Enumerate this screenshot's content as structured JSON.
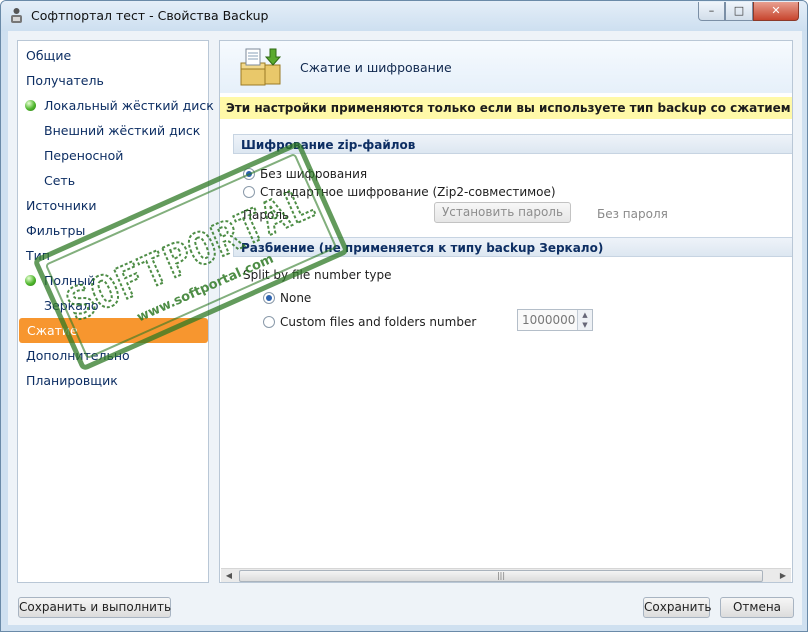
{
  "window": {
    "title": "Софтпортал тест - Свойства Backup",
    "controls": {
      "minimize": "–",
      "maximize": "□",
      "close": "✕"
    }
  },
  "sidebar": {
    "items": [
      {
        "label": "Общие",
        "indent": 0,
        "dot": false,
        "active": false
      },
      {
        "label": "Получатель",
        "indent": 0,
        "dot": false,
        "active": false
      },
      {
        "label": "Локальный жёсткий диск",
        "indent": 1,
        "dot": true,
        "active": false
      },
      {
        "label": "Внешний жёсткий диск",
        "indent": 1,
        "dot": false,
        "active": false
      },
      {
        "label": "Переносной",
        "indent": 1,
        "dot": false,
        "active": false
      },
      {
        "label": "Сеть",
        "indent": 1,
        "dot": false,
        "active": false
      },
      {
        "label": "Источники",
        "indent": 0,
        "dot": false,
        "active": false
      },
      {
        "label": "Фильтры",
        "indent": 0,
        "dot": false,
        "active": false
      },
      {
        "label": "Тип",
        "indent": 0,
        "dot": false,
        "active": false
      },
      {
        "label": "Полный",
        "indent": 1,
        "dot": true,
        "active": false
      },
      {
        "label": "Зеркало",
        "indent": 1,
        "dot": false,
        "active": false
      },
      {
        "label": "Сжатие",
        "indent": 0,
        "dot": false,
        "active": true
      },
      {
        "label": "Дополнительно",
        "indent": 0,
        "dot": false,
        "active": false
      },
      {
        "label": "Планировщик",
        "indent": 0,
        "dot": false,
        "active": false
      }
    ]
  },
  "panel": {
    "title": "Сжатие и шифрование",
    "notice": "Эти настройки применяются только если вы используете тип backup со сжатием zip (наприме",
    "encryption": {
      "header": "Шифрование zip-файлов",
      "options": [
        {
          "label": "Без шифрования",
          "checked": true
        },
        {
          "label": "Стандартное шифрование (Zip2-совместимое)",
          "checked": false
        }
      ],
      "password_label": "Пароль",
      "set_password_button": "Установить пароль",
      "password_status": "Без пароля"
    },
    "split": {
      "header": "Разбиение (не применяется к типу backup Зеркало)",
      "label": "Split by file number type",
      "options": [
        {
          "label": "None",
          "checked": true
        },
        {
          "label": "Custom files and folders number",
          "checked": false
        }
      ],
      "number_value": "1000000"
    },
    "scrollbar_grip": "|||"
  },
  "footer": {
    "save_run_button": "Сохранить и выполнить",
    "save_button": "Сохранить",
    "cancel_button": "Отмена"
  },
  "watermark": {
    "text": "SOFTPORTAL",
    "url": "www.softportal.com"
  },
  "colors": {
    "active_item": "#f7962f",
    "notice_bg": "#fff9a8",
    "nav_text": "#0d2e63",
    "status_dot": "#4fb62d"
  }
}
